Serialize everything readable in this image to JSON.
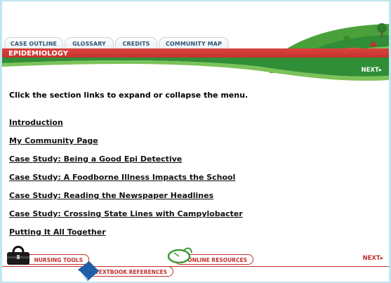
{
  "tabs": [
    "CASE OUTLINE",
    "GLOSSARY",
    "CREDITS",
    "COMMUNITY MAP"
  ],
  "header": {
    "title": "EPIDEMIOLOGY",
    "next_label": "NEXT▸"
  },
  "main": {
    "instructions": "Click the section links to expand or collapse the menu.",
    "links": [
      "Introduction",
      "My Community Page",
      "Case Study: Being a Good Epi Detective",
      "Case Study: A Foodborne Illness Impacts the School",
      "Case Study: Reading the Newspaper Headlines",
      "Case Study: Crossing State Lines with Campylobacter",
      "Putting It All Together"
    ]
  },
  "footer": {
    "nursing_tools": "NURSING TOOLS",
    "online_resources": "ONLINE RESOURCES",
    "textbook_references": "TEXTBOOK REFERENCES",
    "next_label": "NEXT▸"
  },
  "colors": {
    "accent_red": "#c0302c",
    "tab_text": "#2e5677",
    "frame": "#bfe6ef"
  }
}
